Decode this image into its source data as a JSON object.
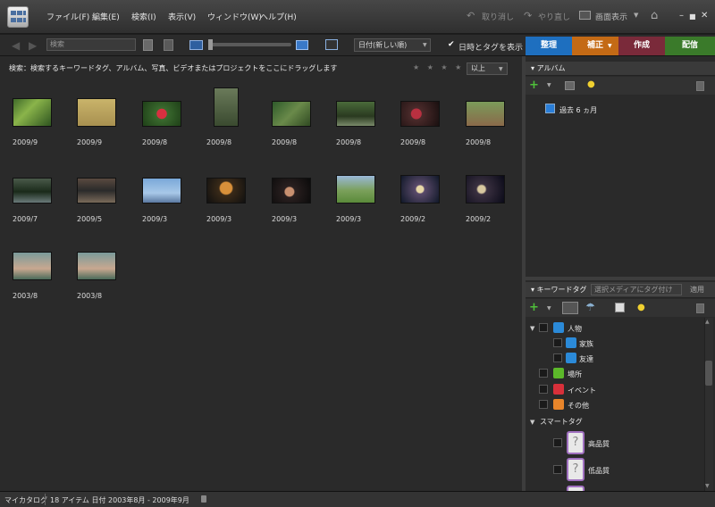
{
  "menu": [
    "ファイル(F)",
    "編集(E)",
    "検索(I)",
    "表示(V)",
    "ウィンドウ(W)",
    "ヘルプ(H)"
  ],
  "titlebar": {
    "undo": "取り消し",
    "redo": "やり直し",
    "display": "画面表示"
  },
  "toolbar": {
    "search_placeholder": "検索",
    "sort": "日付(新しい順)",
    "show_date_tags": "日時とタグを表示"
  },
  "tabs": [
    {
      "label": "整理",
      "color": "#1e6fbf"
    },
    {
      "label": "補正",
      "color": "#c46a15"
    },
    {
      "label": "作成",
      "color": "#7a2a3a"
    },
    {
      "label": "配信",
      "color": "#3a7a2a"
    }
  ],
  "hint": "検索：検索するキーワードタグ、アルバム、写真、ビデオまたはプロジェクトをここにドラッグします",
  "rating": {
    "stars": "★ ★ ★ ★ ★",
    "filter": "以上"
  },
  "photos": [
    {
      "date": "2009/9"
    },
    {
      "date": "2009/9"
    },
    {
      "date": "2009/8"
    },
    {
      "date": "2009/8"
    },
    {
      "date": "2009/8"
    },
    {
      "date": "2009/8"
    },
    {
      "date": "2009/8"
    },
    {
      "date": "2009/8"
    },
    {
      "date": "2009/7"
    },
    {
      "date": "2009/5"
    },
    {
      "date": "2009/3"
    },
    {
      "date": "2009/3"
    },
    {
      "date": "2009/3"
    },
    {
      "date": "2009/3"
    },
    {
      "date": "2009/2"
    },
    {
      "date": "2009/2"
    },
    {
      "date": "2003/8"
    },
    {
      "date": "2003/8"
    }
  ],
  "albums": {
    "title": "アルバム",
    "items": [
      "過去 6 ヵ月"
    ]
  },
  "keywords": {
    "title": "キーワードタグ",
    "placeholder": "選択メディアにタグ付け",
    "apply": "適用",
    "tags": [
      "人物",
      "家族",
      "友達",
      "場所",
      "イベント",
      "その他"
    ],
    "smart_title": "スマートタグ",
    "smart": [
      "高品質",
      "低品質"
    ]
  },
  "status": {
    "catalog": "マイカタログ",
    "summary": "18 アイテム 日付 2003年8月 - 2009年9月"
  }
}
